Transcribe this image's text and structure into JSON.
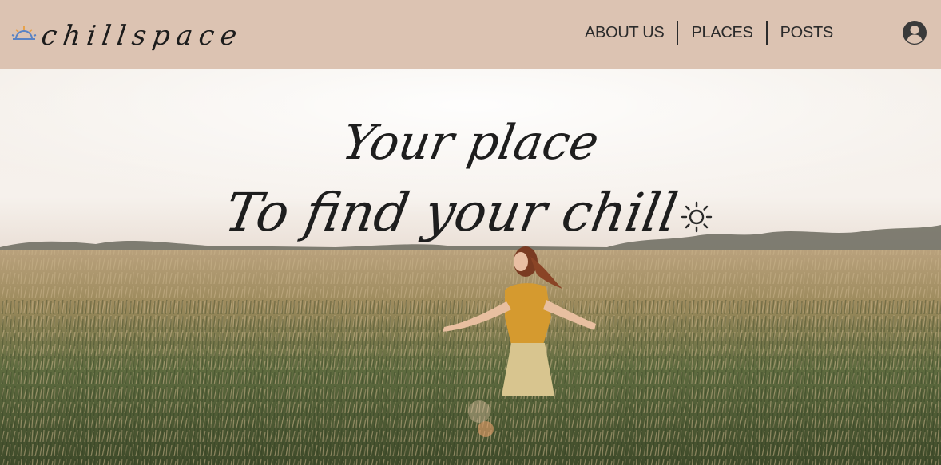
{
  "brand": {
    "name": "chillspace",
    "icon": "sunrise-icon"
  },
  "nav": {
    "items": [
      {
        "label": "ABOUT US"
      },
      {
        "label": "PLACES"
      },
      {
        "label": "POSTS"
      }
    ],
    "account_icon": "user-circle-icon"
  },
  "hero": {
    "line1": "Your place",
    "line2": "To find your chill",
    "line2_icon": "sun-icon",
    "background": "woman-in-wheat-field-at-sunset"
  },
  "colors": {
    "header_bg": "#dcc3b2",
    "text": "#1e1e1e",
    "logo_icon_blue": "#5a83c4",
    "logo_icon_orange": "#e8a24a"
  }
}
